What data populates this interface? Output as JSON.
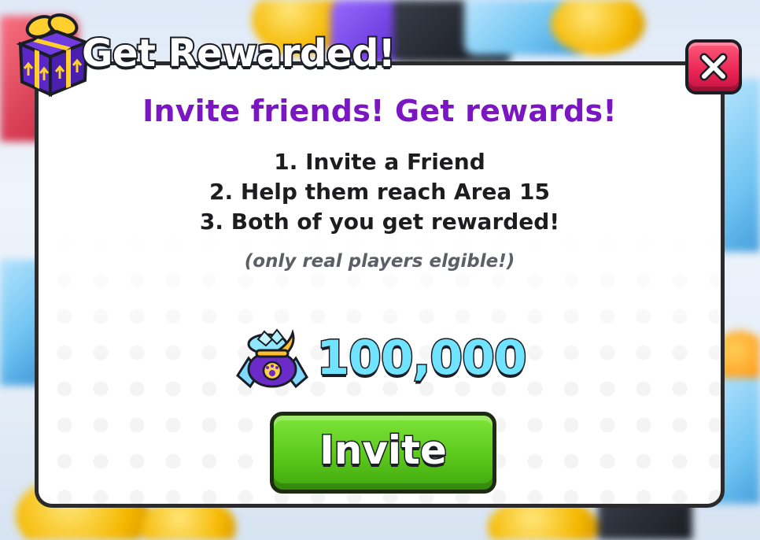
{
  "window": {
    "title": "Get Rewarded!"
  },
  "content": {
    "headline": "Invite friends! Get rewards!",
    "steps": [
      "1. Invite a Friend",
      "2. Help them reach Area 15",
      "3. Both of you get rewarded!"
    ],
    "note": "(only real players elgible!)"
  },
  "reward": {
    "amount": "100,000",
    "icon": "diamond-bag-icon"
  },
  "actions": {
    "invite_label": "Invite",
    "close_icon": "close-icon"
  },
  "colors": {
    "headline": "#7a17c2",
    "reward_amount": "#6fe3ff",
    "invite_button": "#5cc81c",
    "close_button": "#ea2454",
    "panel_border": "#2b2b2e"
  }
}
